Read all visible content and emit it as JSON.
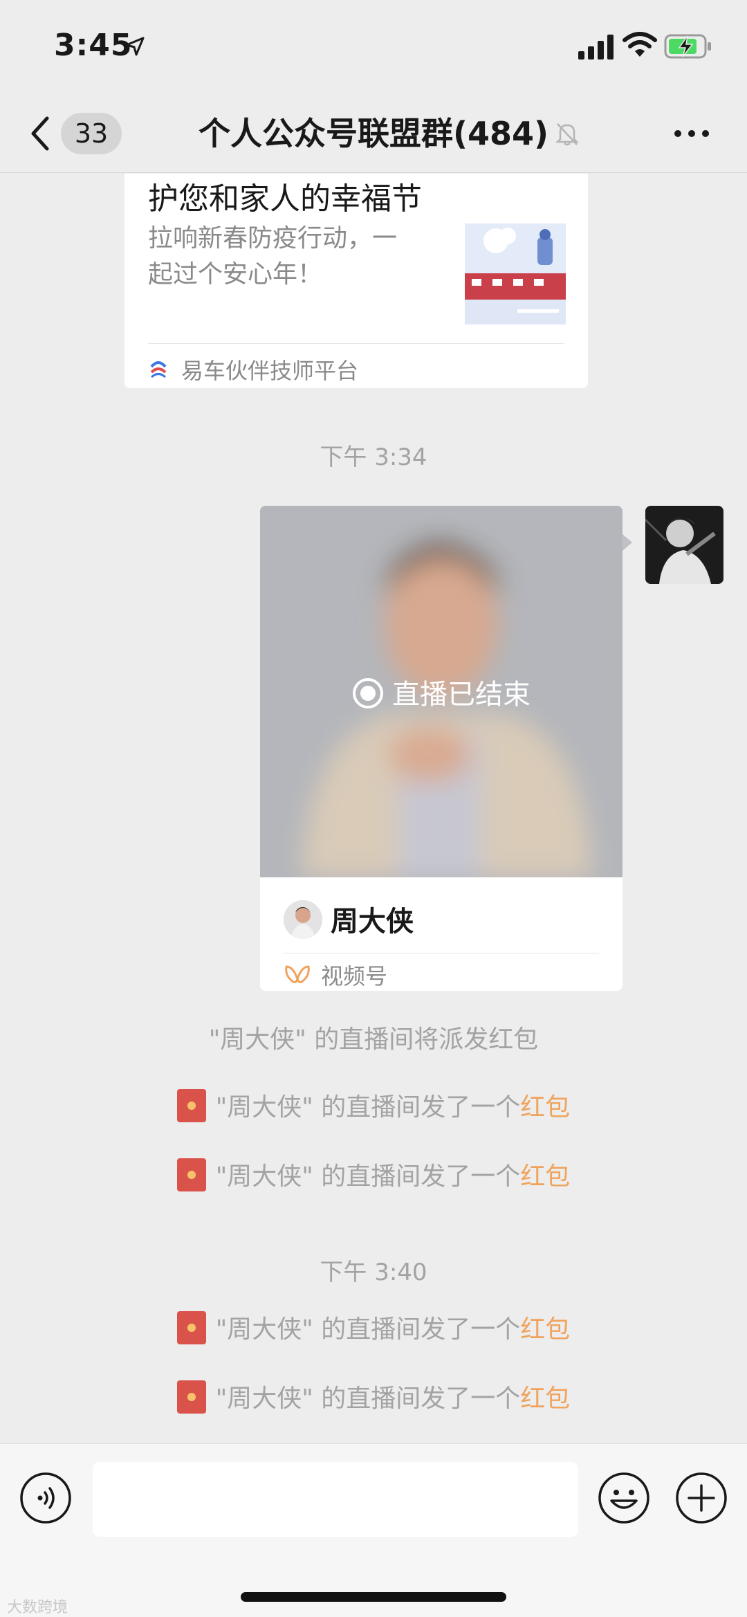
{
  "status_bar": {
    "time": "3:45"
  },
  "nav": {
    "unread_count": "33",
    "title": "个人公众号联盟群(484)"
  },
  "article": {
    "title": "护您和家人的幸福节",
    "description": "拉响新春防疫行动，一起过个安心年！",
    "source": "易车伙伴技师平台"
  },
  "messages": {
    "time_1": "下午 3:34",
    "live": {
      "status": "直播已结束",
      "author": "周大侠",
      "channel": "视频号"
    },
    "notice": "\"周大侠\" 的直播间将派发红包",
    "red_packet_prefix": "\"周大侠\" 的直播间发了一个",
    "red_packet_link": "红包",
    "time_2": "下午 3:40"
  },
  "watermark": "大数跨境",
  "colors": {
    "background": "#ededed",
    "link_orange": "#f0a35c",
    "red_packet": "#d9534a"
  }
}
